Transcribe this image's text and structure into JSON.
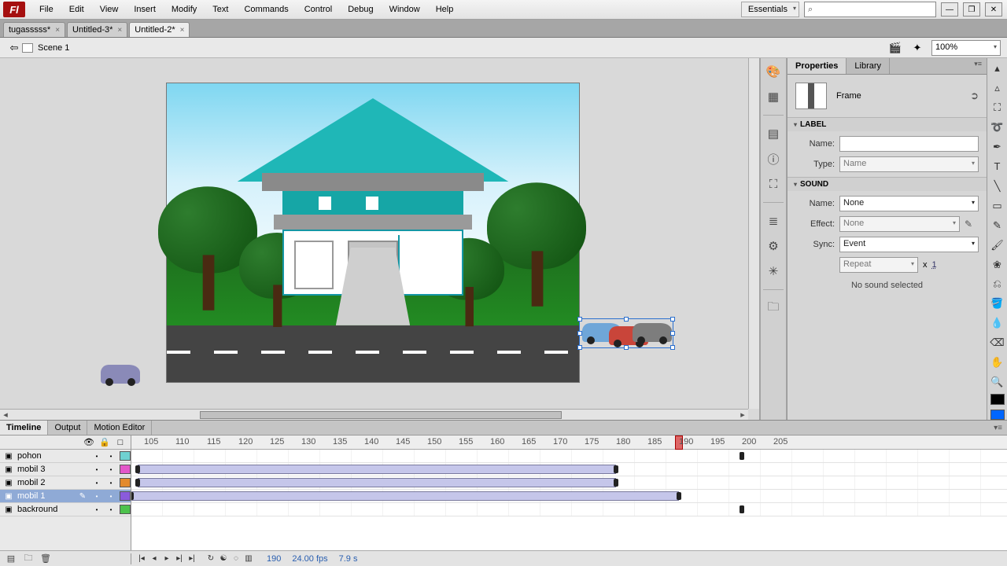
{
  "menu": [
    "File",
    "Edit",
    "View",
    "Insert",
    "Modify",
    "Text",
    "Commands",
    "Control",
    "Debug",
    "Window",
    "Help"
  ],
  "workspace_preset": "Essentials",
  "doc_tabs": [
    {
      "label": "tugasssss*",
      "active": false
    },
    {
      "label": "Untitled-3*",
      "active": false
    },
    {
      "label": "Untitled-2*",
      "active": true
    }
  ],
  "scene_name": "Scene 1",
  "zoom": "100%",
  "panel": {
    "tabs": [
      "Properties",
      "Library"
    ],
    "active_tab": 0,
    "object_type": "Frame",
    "label_section": "LABEL",
    "label_name_label": "Name:",
    "label_name_value": "",
    "label_type_label": "Type:",
    "label_type_value": "Name",
    "sound_section": "SOUND",
    "sound_name_label": "Name:",
    "sound_name_value": "None",
    "sound_effect_label": "Effect:",
    "sound_effect_value": "None",
    "sound_sync_label": "Sync:",
    "sound_sync_value": "Event",
    "sound_repeat_value": "Repeat",
    "sound_repeat_times": "1",
    "sound_x": "x",
    "sound_status": "No sound selected"
  },
  "timeline": {
    "tabs": [
      "Timeline",
      "Output",
      "Motion Editor"
    ],
    "active_tab": 0,
    "ruler_start": 103,
    "ruler_ticks": [
      105,
      110,
      115,
      120,
      125,
      130,
      135,
      140,
      145,
      150,
      155,
      160,
      165,
      170,
      175,
      180,
      185,
      190,
      195,
      200,
      205
    ],
    "playhead": 190,
    "layers": [
      {
        "name": "pohon",
        "color": "#6fd1d1",
        "selected": false
      },
      {
        "name": "mobil 3",
        "color": "#e356c9",
        "selected": false
      },
      {
        "name": "mobil 2",
        "color": "#e38a2c",
        "selected": false
      },
      {
        "name": "mobil 1",
        "color": "#8a5bdc",
        "selected": true
      },
      {
        "name": "backround",
        "color": "#4cc24c",
        "selected": false
      }
    ],
    "footer": {
      "frame": "190",
      "fps": "24.00 fps",
      "time": "7.9 s"
    }
  }
}
